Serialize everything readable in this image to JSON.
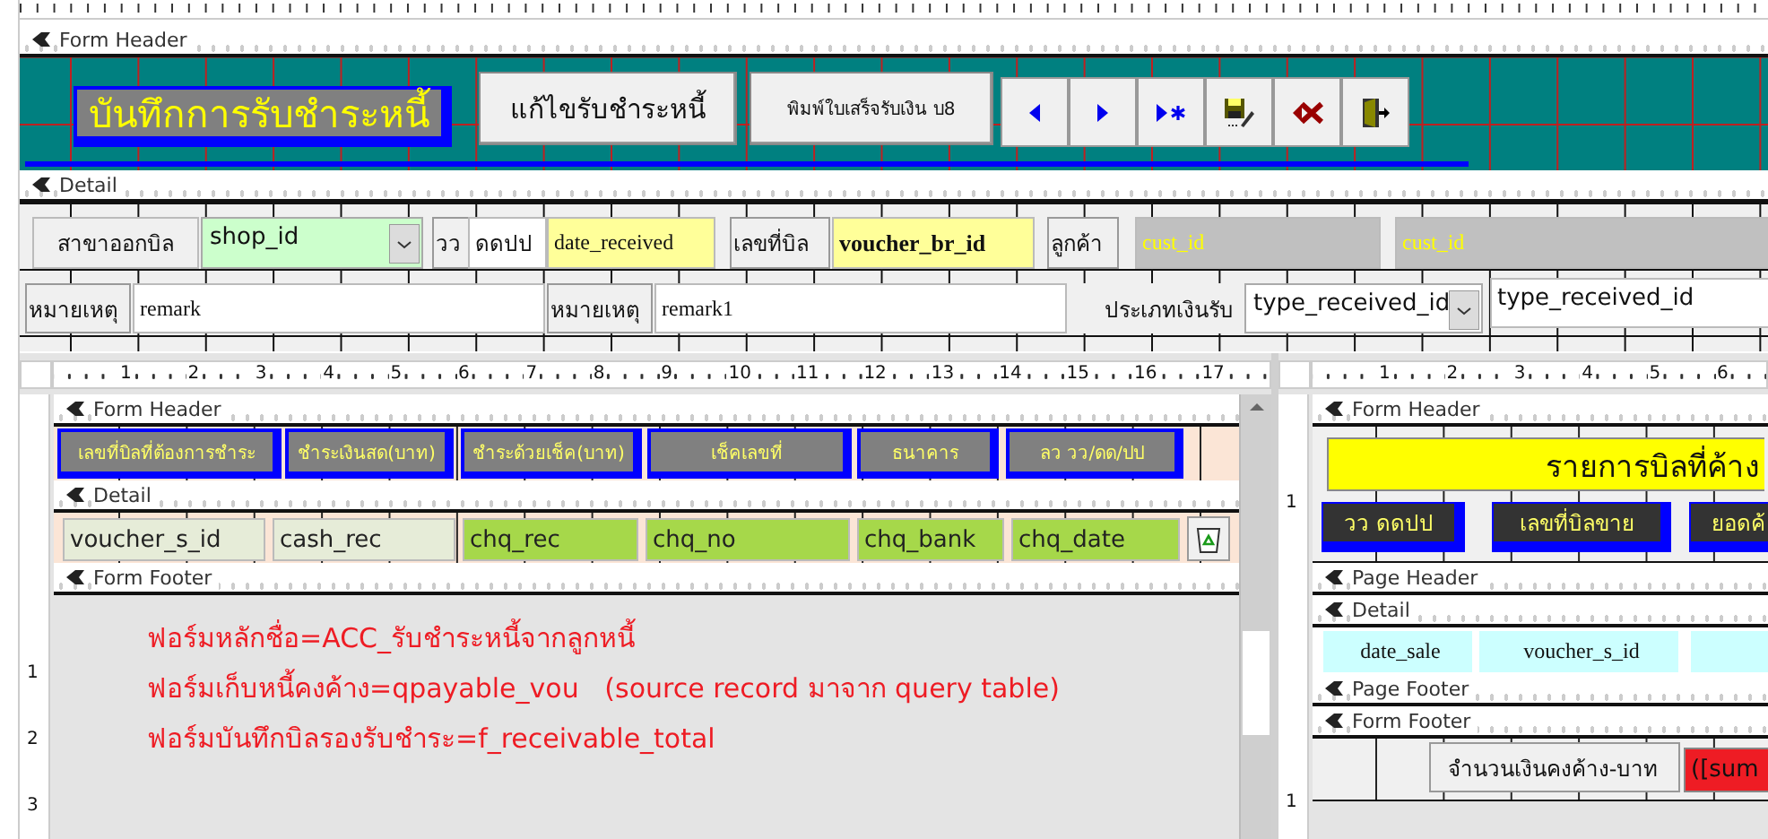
{
  "main_form": {
    "sections": [
      {
        "title": "Form Header",
        "controls": [
          {
            "kind": "title",
            "text": "บันทึกการรับชำระหนี้"
          },
          {
            "kind": "button",
            "text": "แก้ไขรับชำระหนี้"
          },
          {
            "kind": "button",
            "text": "พิมพ์ใบเสร็จรับเงิน บ8"
          },
          {
            "kind": "nav-previous"
          },
          {
            "kind": "nav-next"
          },
          {
            "kind": "nav-new"
          },
          {
            "kind": "nav-save"
          },
          {
            "kind": "nav-delete"
          },
          {
            "kind": "nav-exit"
          }
        ]
      },
      {
        "title": "Detail",
        "controls": [
          {
            "kind": "label",
            "text": "สาขาออกบิล"
          },
          {
            "kind": "combo",
            "text": "shop_id"
          },
          {
            "kind": "label",
            "text": "วว"
          },
          {
            "kind": "field",
            "text": "ดดปป"
          },
          {
            "kind": "field",
            "text": "date_received"
          },
          {
            "kind": "label",
            "text": "เลขที่บิล"
          },
          {
            "kind": "field",
            "text": "voucher_br_id"
          },
          {
            "kind": "label",
            "text": "ลูกค้า"
          },
          {
            "kind": "field",
            "text": "cust_id"
          },
          {
            "kind": "field",
            "text": "cust_id"
          },
          {
            "kind": "label",
            "text": "หมายเหตุ"
          },
          {
            "kind": "field",
            "text": "remark"
          },
          {
            "kind": "label",
            "text": "หมายเหตุ"
          },
          {
            "kind": "field",
            "text": "remark1"
          },
          {
            "kind": "label",
            "text": "ประเภทเงินรับ"
          },
          {
            "kind": "combo",
            "text": "type_received_id"
          },
          {
            "kind": "field",
            "text": "type_received_id"
          }
        ]
      }
    ]
  },
  "payment_subform": {
    "ruler_marks": [
      "1",
      "2",
      "3",
      "4",
      "5",
      "6",
      "7",
      "8",
      "9",
      "10",
      "11",
      "12",
      "13",
      "14",
      "15",
      "16",
      "17"
    ],
    "side_marks": [
      "1",
      "2",
      "3"
    ],
    "sections": [
      {
        "title": "Form Header",
        "controls": [
          {
            "kind": "header",
            "text": "เลขที่บิลที่ต้องการชำระ"
          },
          {
            "kind": "header",
            "text": "ชำระเงินสด(บาท)"
          },
          {
            "kind": "header",
            "text": "ชำระด้วยเช็ค(บาท)"
          },
          {
            "kind": "header",
            "text": "เช็คเลขที่"
          },
          {
            "kind": "header",
            "text": "ธนาคาร"
          },
          {
            "kind": "header",
            "text": "ลว  วว/ดด/ปป"
          }
        ]
      },
      {
        "title": "Detail",
        "controls": [
          {
            "kind": "field",
            "text": "voucher_s_id"
          },
          {
            "kind": "field",
            "text": "cash_rec"
          },
          {
            "kind": "field",
            "text": "chq_rec"
          },
          {
            "kind": "field",
            "text": "chq_no"
          },
          {
            "kind": "field",
            "text": "chq_bank"
          },
          {
            "kind": "field",
            "text": "chq_date"
          },
          {
            "kind": "bin"
          }
        ]
      },
      {
        "title": "Form Footer",
        "controls": [
          {
            "kind": "note",
            "text": "ฟอร์มหลักชื่อ=ACC_รับชำระหนี้จากลูกหนี้"
          },
          {
            "kind": "note",
            "text": "ฟอร์มเก็บหนี้คงค้าง=qpayable_vou   (source record มาจาก query table)"
          },
          {
            "kind": "note",
            "text": "ฟอร์มบันทึกบิลรองรับชำระ=f_receivable_total"
          }
        ]
      }
    ]
  },
  "bills_subform": {
    "ruler_marks": [
      "1",
      "2",
      "3",
      "4",
      "5",
      "6"
    ],
    "side_marks": [
      "1",
      "1"
    ],
    "sections": [
      {
        "title": "Form Header",
        "controls": [
          {
            "kind": "banner",
            "text": "รายการบิลที่ค้าง"
          },
          {
            "kind": "caption",
            "text": "วว ดดปป"
          },
          {
            "kind": "caption",
            "text": "เลขที่บิลขาย"
          },
          {
            "kind": "caption",
            "text": "ยอดค้"
          }
        ]
      },
      {
        "title": "Page Header"
      },
      {
        "title": "Detail",
        "controls": [
          {
            "kind": "field",
            "text": "date_sale"
          },
          {
            "kind": "field",
            "text": "voucher_s_id"
          },
          {
            "kind": "field"
          }
        ]
      },
      {
        "title": "Page Footer"
      },
      {
        "title": "Form Footer",
        "controls": [
          {
            "kind": "label",
            "text": "จำนวนเงินคงค้าง-บาท"
          },
          {
            "kind": "field",
            "text": "([sum"
          }
        ]
      }
    ]
  }
}
